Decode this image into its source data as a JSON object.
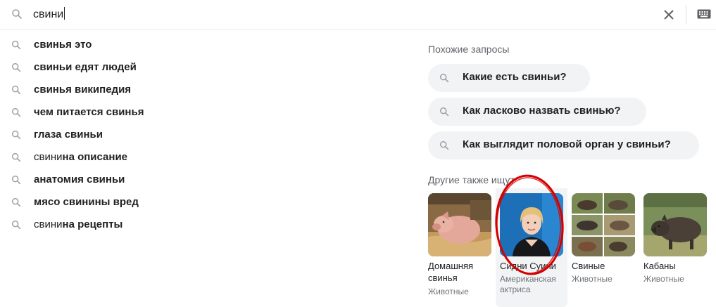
{
  "search": {
    "query": "свини",
    "clear_icon": "close-icon",
    "keyboard_icon": "keyboard-icon"
  },
  "suggestions": [
    {
      "prefix": "",
      "bold": "свинья это"
    },
    {
      "prefix": "",
      "bold": "свиньи едят людей"
    },
    {
      "prefix": "",
      "bold": "свинья википедия"
    },
    {
      "prefix": "",
      "bold": "чем питается свинья"
    },
    {
      "prefix": "",
      "bold": "глаза свиньи"
    },
    {
      "prefix": "свини",
      "bold": "на описание"
    },
    {
      "prefix": "",
      "bold": "анатомия свиньи"
    },
    {
      "prefix": "",
      "bold": "мясо свинины вред"
    },
    {
      "prefix": "свини",
      "bold": "на рецепты"
    }
  ],
  "related": {
    "title": "Похожие запросы",
    "items": [
      "Какие есть свиньи?",
      "Как ласково назвать свинью?",
      "Как выглядит половой орган у свиньи?"
    ]
  },
  "also_search": {
    "title": "Другие также ищут",
    "cards": [
      {
        "name": "Домашняя свинья",
        "sub": "Животные"
      },
      {
        "name": "Сидни Суини",
        "sub": "Американская актриса"
      },
      {
        "name": "Свиные",
        "sub": "Животные"
      },
      {
        "name": "Кабаны",
        "sub": "Животные"
      }
    ]
  },
  "colors": {
    "pill_bg": "#f1f3f4",
    "annotation": "#d40000",
    "muted_text": "#70757a"
  }
}
